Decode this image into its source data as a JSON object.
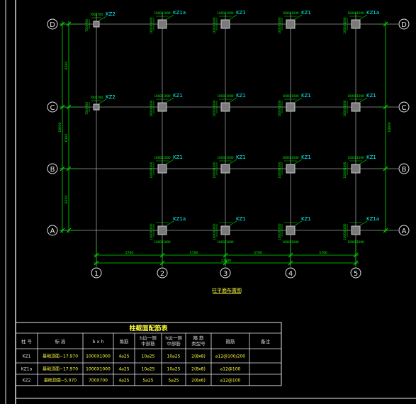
{
  "colors": {
    "background": "#000000",
    "axis": "#9a9a9a",
    "dimension": "#00e000",
    "dim_text": "#00ff00",
    "column": "#c8c8c8",
    "label": "#00ffff",
    "frame": "#e6e6e6",
    "table_text": "#d8d8d8",
    "table_data": "#ffff40",
    "title": "#ffff40"
  },
  "grid": {
    "col_labels": [
      "1",
      "2",
      "3",
      "4",
      "5"
    ],
    "row_labels": [
      "D",
      "C",
      "B",
      "A"
    ]
  },
  "dims": {
    "bottom_spans": [
      "5700",
      "5700",
      "5700",
      "5700"
    ],
    "bottom_total": "22800",
    "left_spans": [
      "6300",
      "6300",
      "6300"
    ],
    "left_total": "18900",
    "right_total": "18900"
  },
  "drawing_title": "柱平面布置图",
  "columns": [
    {
      "r": 0,
      "c": 0,
      "label": "KZ2",
      "sec": "700X700"
    },
    {
      "r": 0,
      "c": 1,
      "label": "KZ1a",
      "sec": "1000X1000"
    },
    {
      "r": 0,
      "c": 2,
      "label": "KZ1",
      "sec": "1000X1000"
    },
    {
      "r": 0,
      "c": 3,
      "label": "KZ1",
      "sec": "1000X1000"
    },
    {
      "r": 0,
      "c": 4,
      "label": "KZ1a",
      "sec": "1000X1000"
    },
    {
      "r": 1,
      "c": 0,
      "label": "KZ2",
      "sec": "700X700"
    },
    {
      "r": 1,
      "c": 1,
      "label": "KZ1",
      "sec": "1000X1000"
    },
    {
      "r": 1,
      "c": 2,
      "label": "KZ1",
      "sec": "1000X1000"
    },
    {
      "r": 1,
      "c": 3,
      "label": "KZ1",
      "sec": "1000X1000"
    },
    {
      "r": 1,
      "c": 4,
      "label": "KZ1",
      "sec": "1000X1000"
    },
    {
      "r": 2,
      "c": 1,
      "label": "KZ1",
      "sec": "1000X1000"
    },
    {
      "r": 2,
      "c": 2,
      "label": "KZ1",
      "sec": "1000X1000"
    },
    {
      "r": 2,
      "c": 3,
      "label": "KZ1",
      "sec": "1000X1000"
    },
    {
      "r": 2,
      "c": 4,
      "label": "KZ1",
      "sec": "1000X1000"
    },
    {
      "r": 3,
      "c": 1,
      "label": "KZ1a",
      "sec": "1000X1000"
    },
    {
      "r": 3,
      "c": 2,
      "label": "KZ1",
      "sec": "1000X1000"
    },
    {
      "r": 3,
      "c": 3,
      "label": "KZ1",
      "sec": "1000X1000"
    },
    {
      "r": 3,
      "c": 4,
      "label": "KZ1a",
      "sec": "1000X1000"
    }
  ],
  "table": {
    "title": "柱截面配筋表",
    "headers": [
      "柱 号",
      "标 高",
      "b x h",
      "角筋",
      "b边一侧\n中部筋",
      "h边一侧\n中部筋",
      "箍 筋\n类型号",
      "箍筋",
      "备注"
    ],
    "rows": [
      [
        "KZ1",
        "基础顶面~17.970",
        "1000X1000",
        "4⌀25",
        "10⌀25",
        "10⌀25",
        "2(8x8)",
        "⌀12@100/200",
        ""
      ],
      [
        "KZ1a",
        "基础顶面~17.970",
        "1000X1000",
        "4⌀25",
        "10⌀25",
        "10⌀25",
        "2(8x8)",
        "⌀12@100",
        ""
      ],
      [
        "KZ2",
        "基础顶面~5.070",
        "700X700",
        "4⌀25",
        "5⌀25",
        "5⌀25",
        "2(6x6)",
        "⌀12@100",
        ""
      ]
    ]
  }
}
